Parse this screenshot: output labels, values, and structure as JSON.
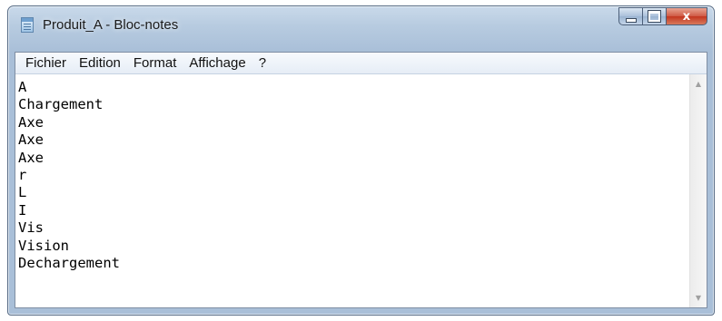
{
  "window": {
    "title": "Produit_A - Bloc-notes",
    "icon": "notepad-icon",
    "controls": {
      "minimize_icon": "minimize-icon",
      "maximize_icon": "maximize-icon",
      "close_icon": "close-icon",
      "close_glyph": "x",
      "close_color": "#c3361f"
    }
  },
  "menu": {
    "items": [
      {
        "label": "Fichier"
      },
      {
        "label": "Edition"
      },
      {
        "label": "Format"
      },
      {
        "label": "Affichage"
      },
      {
        "label": "?"
      }
    ]
  },
  "editor": {
    "lines": [
      "A",
      "Chargement",
      "Axe",
      "Axe",
      "Axe",
      "r",
      "L",
      "I",
      "Vis",
      "Vision",
      "Dechargement"
    ]
  },
  "scrollbar": {
    "up_glyph": "▲",
    "down_glyph": "▼"
  }
}
